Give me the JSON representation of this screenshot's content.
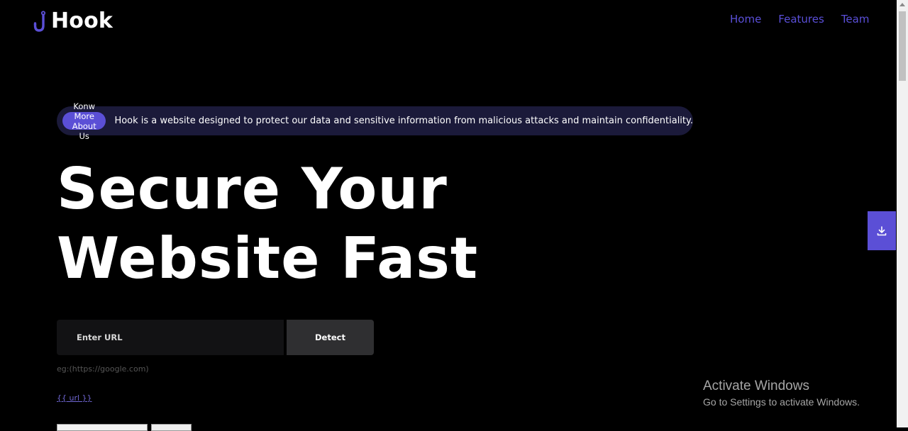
{
  "brand": {
    "name": "Hook",
    "accent": "#5b4fd6",
    "icon": "hook-icon"
  },
  "nav": {
    "items": [
      "Home",
      "Features",
      "Team"
    ]
  },
  "pill": {
    "button_label": "Konw More About Us",
    "text": "Hook is a website designed to protect our data and sensitive information from malicious attacks and maintain confidentiality."
  },
  "hero": {
    "line1": "Secure Your",
    "line2": "Website Fast"
  },
  "form": {
    "url_placeholder": "Enter URL",
    "detect_label": "Detect",
    "hint": "eg:(https://google.com)",
    "url_template": "{{ url }}"
  },
  "fab": {
    "icon": "download-icon"
  },
  "watermark": {
    "title": "Activate Windows",
    "subtitle": "Go to Settings to activate Windows."
  }
}
